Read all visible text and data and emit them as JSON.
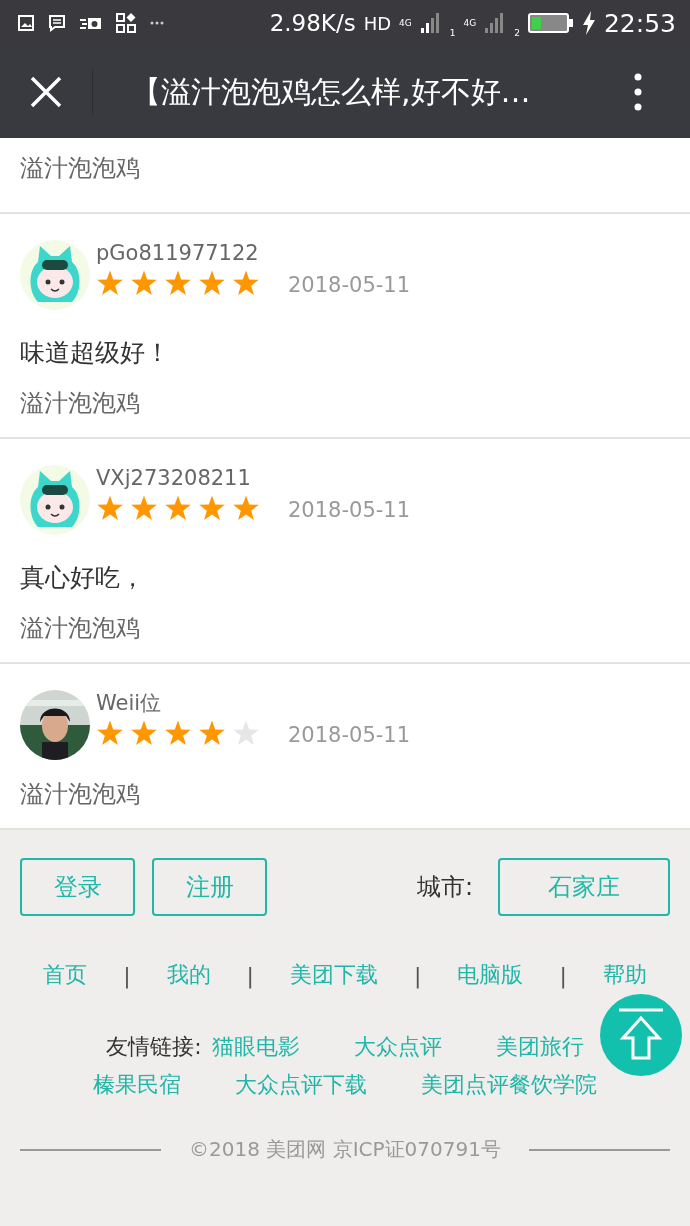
{
  "status_bar": {
    "speed": "2.98K/s",
    "hd": "HD",
    "network_labels": [
      "4G",
      "4G"
    ],
    "sim_labels": [
      "1",
      "2"
    ],
    "time": "22:53"
  },
  "title_bar": {
    "title": "【溢汁泡泡鸡怎么样,好不好…"
  },
  "top_tag": "溢汁泡泡鸡",
  "reviews": [
    {
      "username": "pGo811977122",
      "avatar": {
        "kind": "mascot"
      },
      "stars": 5,
      "date": "2018-05-11",
      "comment": "味道超级好！",
      "tag": "溢汁泡泡鸡"
    },
    {
      "username": "VXj273208211",
      "avatar": {
        "kind": "mascot"
      },
      "stars": 5,
      "date": "2018-05-11",
      "comment": "真心好吃，",
      "tag": "溢汁泡泡鸡"
    },
    {
      "username": "Weii位",
      "stars": 4,
      "date": "2018-05-11",
      "tag": "溢汁泡泡鸡"
    }
  ],
  "footer": {
    "account_buttons": [
      "登录",
      "注册"
    ],
    "city_label": "城市:",
    "city": "石家庄",
    "nav_links": [
      "首页",
      "我的",
      "美团下载",
      "电脑版",
      "帮助"
    ],
    "nav_separators": [
      "|",
      "|",
      "|",
      "|"
    ],
    "friend_label": "友情链接:",
    "friend_link_rows": [
      [
        "猫眼电影",
        "大众点评",
        "美团旅行"
      ],
      [
        "榛果民宿",
        "大众点评下载",
        "美团点评餐饮学院"
      ]
    ],
    "copyright": "©2018 美团网 京ICP证070791号"
  }
}
